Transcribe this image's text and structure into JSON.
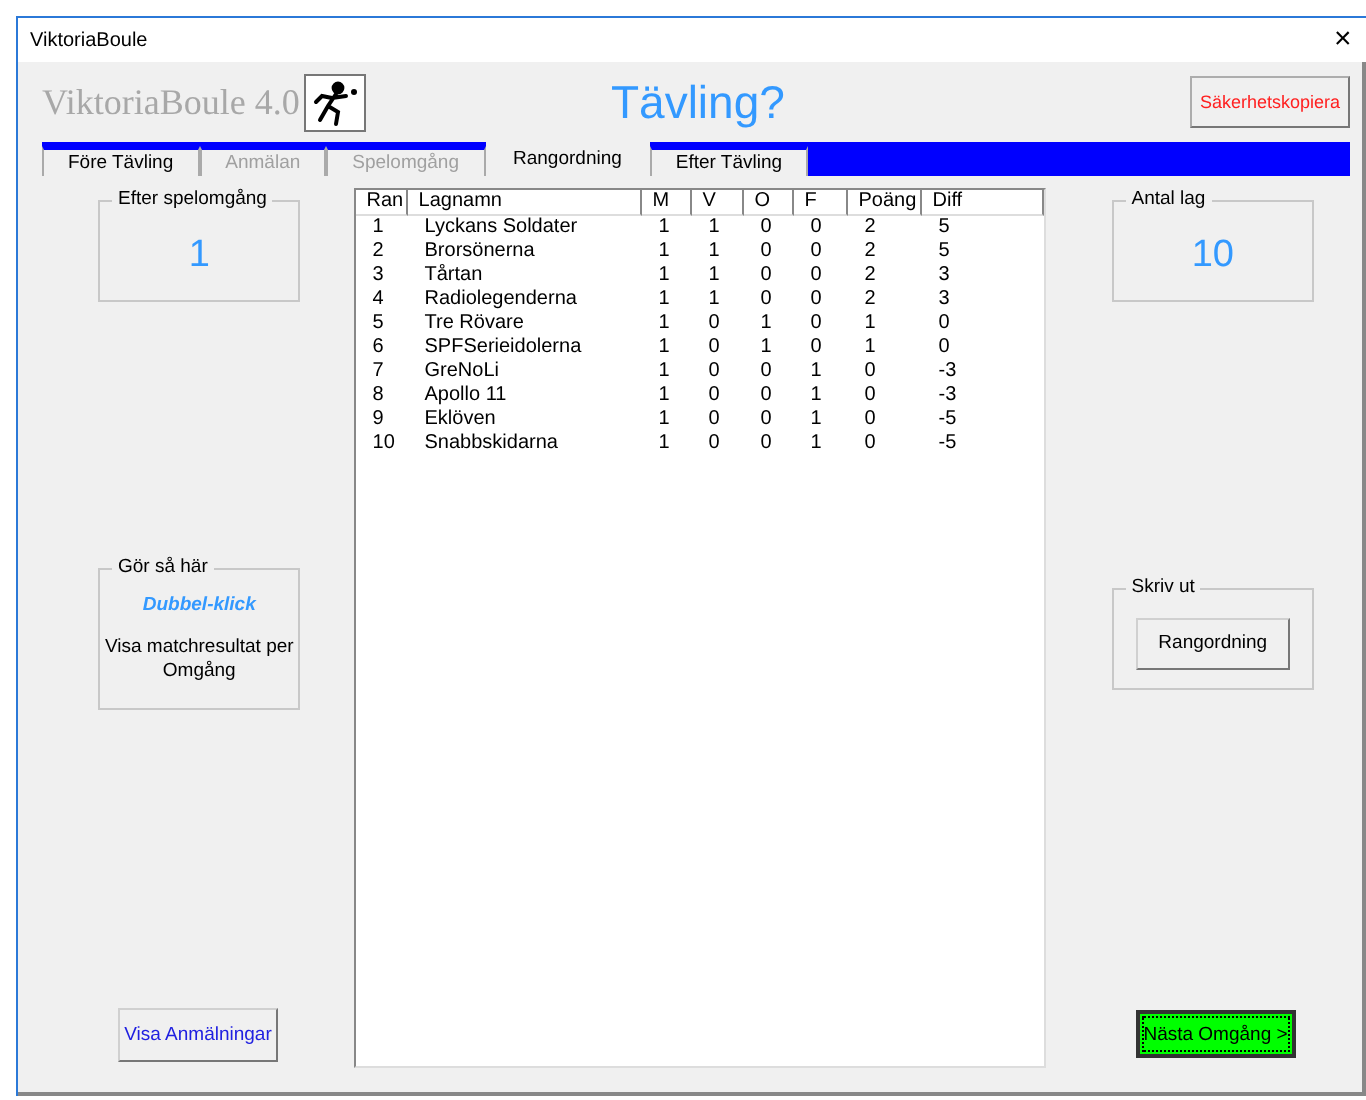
{
  "window": {
    "title": "ViktoriaBoule",
    "close": "×"
  },
  "header": {
    "logo_text": "ViktoriaBoule 4.0",
    "title": "Tävling?",
    "backup_button": "Säkerhetskopiera"
  },
  "tabs": [
    {
      "label": "Före Tävling",
      "selected": false,
      "disabled": false
    },
    {
      "label": "Anmälan",
      "selected": false,
      "disabled": true
    },
    {
      "label": "Spelomgång",
      "selected": false,
      "disabled": true
    },
    {
      "label": "Rangordning",
      "selected": true,
      "disabled": false
    },
    {
      "label": "Efter Tävling",
      "selected": false,
      "disabled": false
    }
  ],
  "after_round": {
    "label": "Efter spelomgång",
    "value": "1"
  },
  "howto": {
    "label": "Gör så här",
    "action": "Dubbel-klick",
    "text": "Visa matchresultat per Omgång"
  },
  "show_entries_button": "Visa Anmälningar",
  "table": {
    "columns": [
      "Ran",
      "Lagnamn",
      "M",
      "V",
      "O",
      "F",
      "Poäng",
      "Diff"
    ],
    "rows": [
      [
        "1",
        "Lyckans Soldater",
        "1",
        "1",
        "0",
        "0",
        "2",
        "5"
      ],
      [
        "2",
        "Brorsönerna",
        "1",
        "1",
        "0",
        "0",
        "2",
        "5"
      ],
      [
        "3",
        "Tårtan",
        "1",
        "1",
        "0",
        "0",
        "2",
        "3"
      ],
      [
        "4",
        "Radiolegenderna",
        "1",
        "1",
        "0",
        "0",
        "2",
        "3"
      ],
      [
        "5",
        "Tre Rövare",
        "1",
        "0",
        "1",
        "0",
        "1",
        "0"
      ],
      [
        "6",
        "SPFSerieidolerna",
        "1",
        "0",
        "1",
        "0",
        "1",
        "0"
      ],
      [
        "7",
        "GreNoLi",
        "1",
        "0",
        "0",
        "1",
        "0",
        "-3"
      ],
      [
        "8",
        "Apollo 11",
        "1",
        "0",
        "0",
        "1",
        "0",
        "-3"
      ],
      [
        "9",
        "Eklöven",
        "1",
        "0",
        "0",
        "1",
        "0",
        "-5"
      ],
      [
        "10",
        "Snabbskidarna",
        "1",
        "0",
        "0",
        "1",
        "0",
        "-5"
      ]
    ]
  },
  "team_count": {
    "label": "Antal lag",
    "value": "10"
  },
  "print": {
    "label": "Skriv ut",
    "button": "Rangordning"
  },
  "next_round_button": "Nästa Omgång >"
}
